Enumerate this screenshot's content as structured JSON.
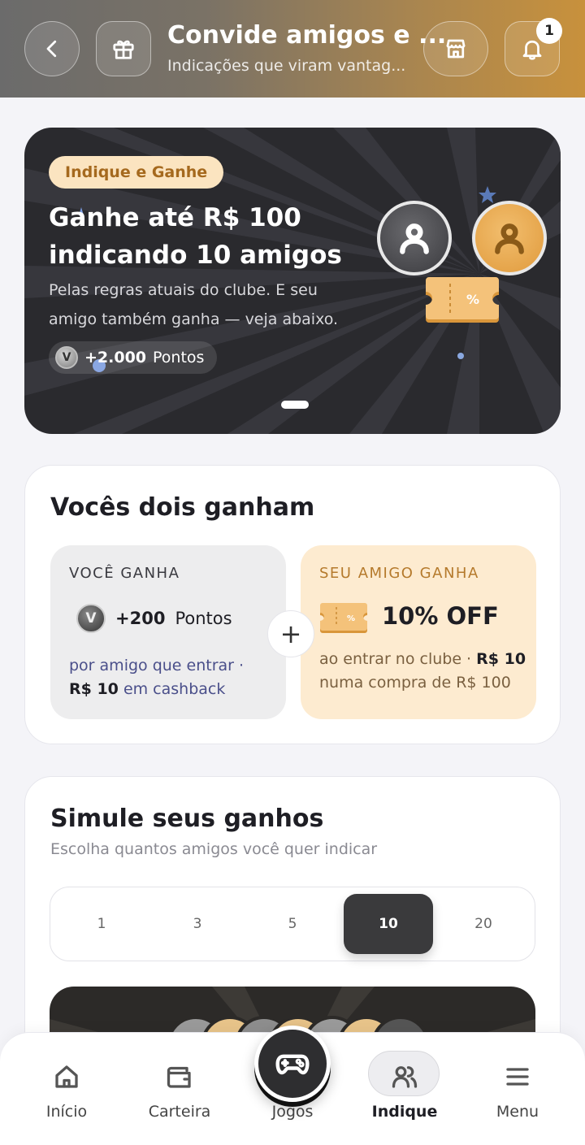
{
  "header": {
    "title": "Convide amigos e ...",
    "subtitle": "Indicações que viram vantag...",
    "notification_count": "1"
  },
  "hero": {
    "tag": "Indique e Ganhe",
    "title_line1": "Ganhe até R$ 100",
    "title_line2": "indicando 10 amigos",
    "desc_line1": "Pelas regras atuais do clube. E seu",
    "desc_line2": "amigo também ganha — veja abaixo.",
    "points": "+2.000",
    "points_unit": "Pontos",
    "coin_letter": "V",
    "ticket_symbol": "%"
  },
  "both_win": {
    "title": "Vocês dois ganham",
    "you": {
      "label": "VOCÊ GANHA",
      "points": "+200",
      "points_unit": "Pontos",
      "desc_line1": "por amigo que entrar ·",
      "desc_bold": "R$ 10",
      "desc_line2": " em cashback"
    },
    "plus": "+",
    "friend": {
      "label": "SEU AMIGO GANHA",
      "discount": "10% OFF",
      "desc_line1": "ao entrar no clube · ",
      "desc_bold": "R$ 10",
      "desc_line2": "numa compra de R$ 100"
    }
  },
  "simulate": {
    "title": "Simule seus ganhos",
    "subtitle": "Escolha quantos amigos você quer indicar",
    "options": [
      "1",
      "3",
      "5",
      "10",
      "20"
    ],
    "selected": "10"
  },
  "nav": {
    "items": [
      {
        "label": "Início",
        "icon": "home-icon"
      },
      {
        "label": "Carteira",
        "icon": "wallet-icon"
      },
      {
        "label": "Jogos",
        "icon": "gamepad-icon"
      },
      {
        "label": "Indique",
        "icon": "users-icon"
      },
      {
        "label": "Menu",
        "icon": "menu-icon"
      }
    ],
    "active": "Indique"
  },
  "colors": {
    "accent_gold": "#c8913c",
    "dark": "#2a2a2e",
    "friend_bg": "#fdebd0",
    "you_bg": "#ededee"
  }
}
